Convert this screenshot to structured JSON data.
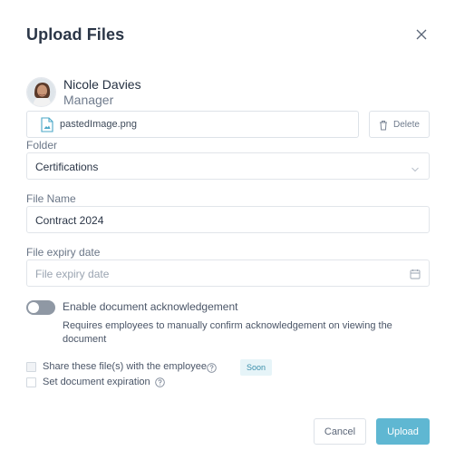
{
  "dialog": {
    "title": "Upload Files",
    "close_icon": "close-icon"
  },
  "user": {
    "name": "Nicole Davies",
    "role": "Manager",
    "avatar_icon": "avatar-photo"
  },
  "file": {
    "name": "pastedImage.png",
    "icon": "image-file-icon",
    "delete_label": "Delete",
    "delete_icon": "trash-icon"
  },
  "folder": {
    "label": "Folder",
    "value": "Certifications",
    "icon": "chevron-down-icon"
  },
  "file_name_field": {
    "label": "File Name",
    "value": "Contract 2024"
  },
  "expiry": {
    "label": "File expiry date",
    "placeholder": "File expiry date",
    "icon": "calendar-icon"
  },
  "acknowledgement": {
    "label": "Enable document acknowledgement",
    "description": "Requires employees to manually confirm acknowledgement on viewing the document",
    "enabled": false
  },
  "options": {
    "share_label": "Share these file(s) with the employee",
    "share_badge": "Soon",
    "expiration_label": "Set document expiration",
    "help_icon": "help-icon"
  },
  "footer": {
    "cancel_label": "Cancel",
    "upload_label": "Upload"
  },
  "colors": {
    "accent": "#5fb7d2",
    "toggle_off": "#8f98a4",
    "badge_bg": "#e6f4f8",
    "badge_text": "#3b8fab"
  }
}
